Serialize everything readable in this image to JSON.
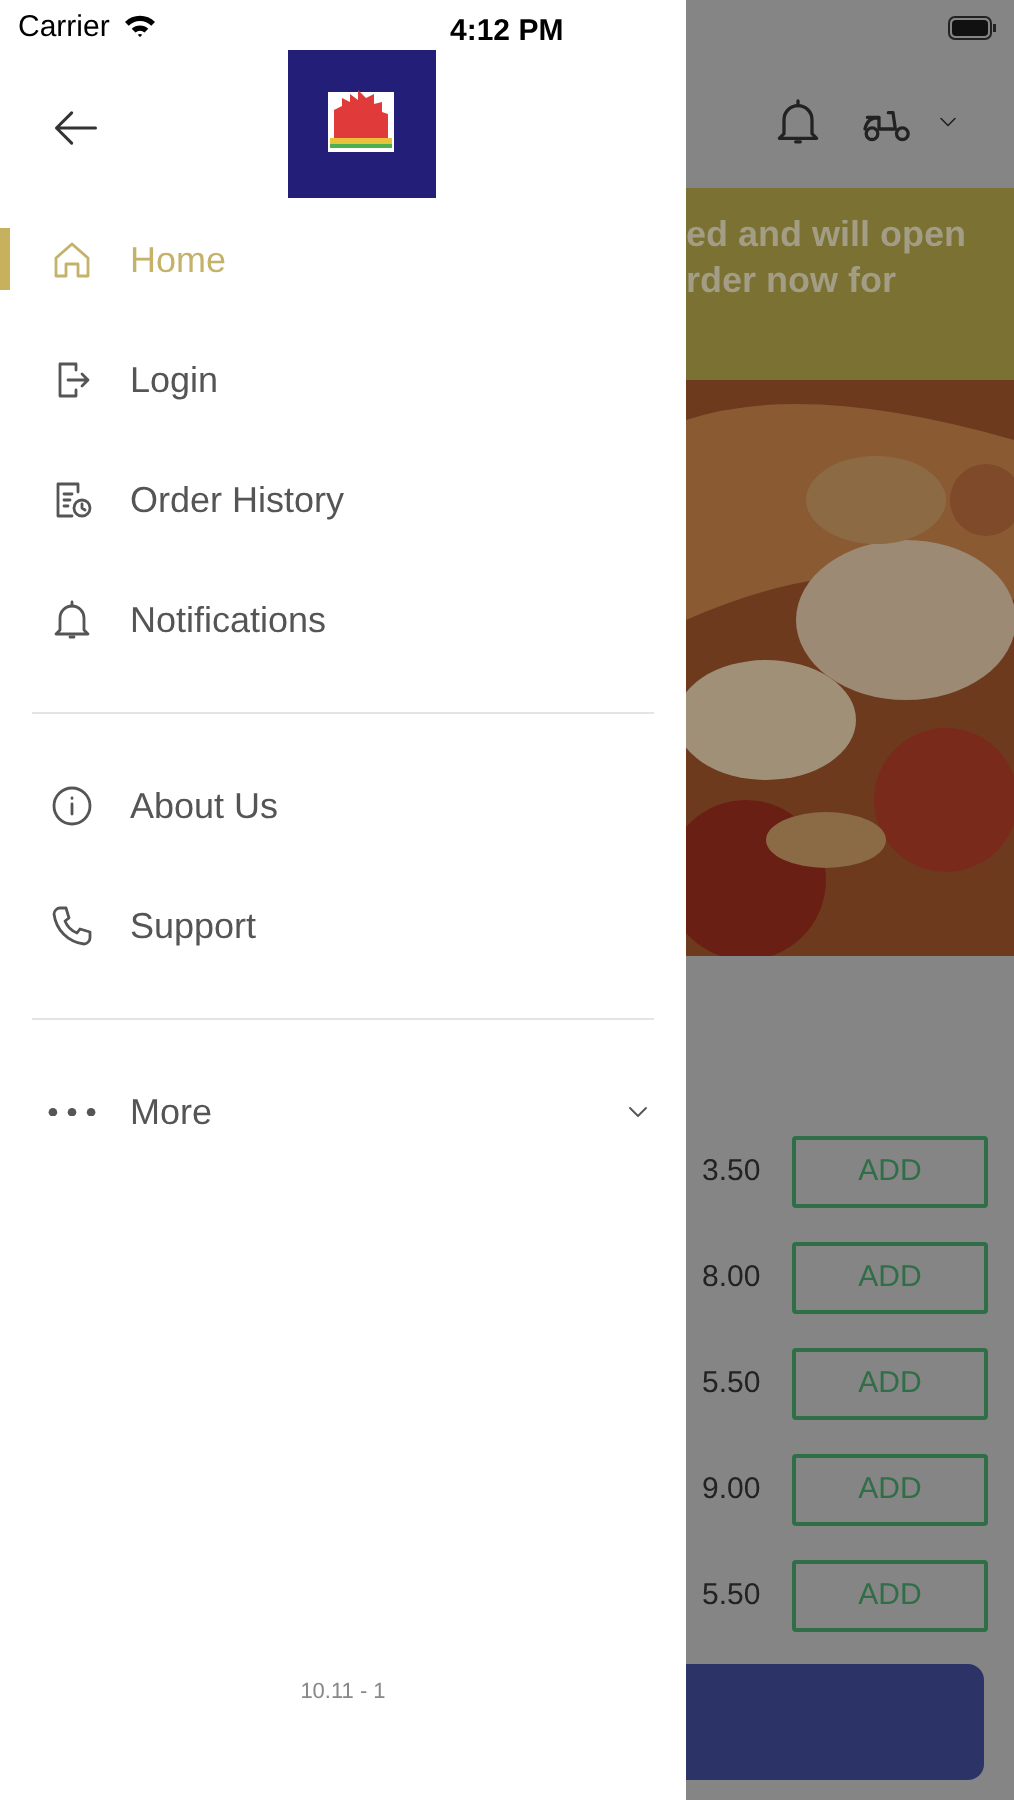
{
  "status_bar": {
    "carrier": "Carrier",
    "time": "4:12 PM"
  },
  "drawer": {
    "sections": [
      [
        {
          "kind": "home",
          "label": "Home",
          "selected": true
        },
        {
          "kind": "login",
          "label": "Login",
          "selected": false
        },
        {
          "kind": "history",
          "label": "Order History",
          "selected": false
        },
        {
          "kind": "bell",
          "label": "Notifications",
          "selected": false
        }
      ],
      [
        {
          "kind": "info",
          "label": "About Us",
          "selected": false
        },
        {
          "kind": "phone",
          "label": "Support",
          "selected": false
        }
      ],
      [
        {
          "kind": "more",
          "label": "More",
          "selected": false,
          "expanded": false
        }
      ]
    ],
    "version": "10.11 - 1"
  },
  "background": {
    "banner_lines": [
      "ed and will open",
      "rder now for"
    ],
    "menu_rows": [
      {
        "price": "3.50",
        "button": "ADD"
      },
      {
        "price": "8.00",
        "button": "ADD"
      },
      {
        "price": "5.50",
        "button": "ADD"
      },
      {
        "price": "9.00",
        "button": "ADD"
      },
      {
        "price": "5.50",
        "button": "ADD"
      }
    ]
  }
}
